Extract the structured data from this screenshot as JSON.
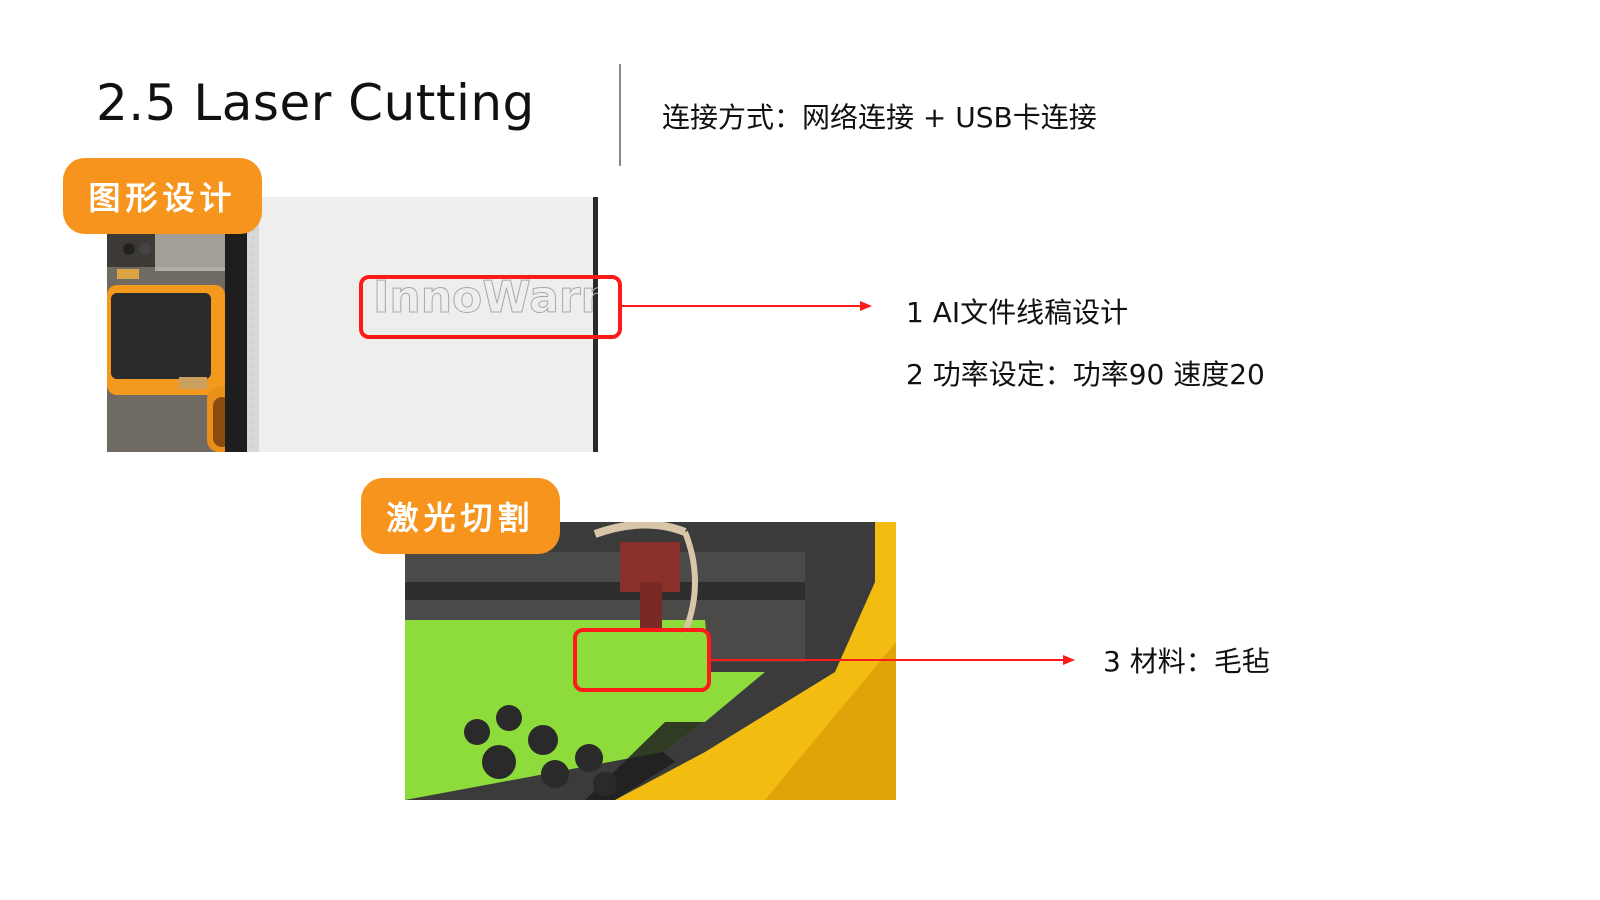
{
  "header": {
    "title": "2.5 Laser Cutting",
    "connection": "连接方式：网络连接 + USB卡连接"
  },
  "section_design": {
    "tag": "图形设计",
    "photo_text": "InnoWarm",
    "notes": [
      "1 AI文件线稿设计",
      "2 功率设定：功率90 速度20"
    ]
  },
  "section_cutting": {
    "tag": "激光切割",
    "notes": [
      "3 材料：毛毡"
    ]
  },
  "colors": {
    "accent_tag": "#f7941d",
    "highlight": "#ff1a1a",
    "felt_green": "#8ddc3c",
    "machine_yellow": "#f2bd10"
  }
}
